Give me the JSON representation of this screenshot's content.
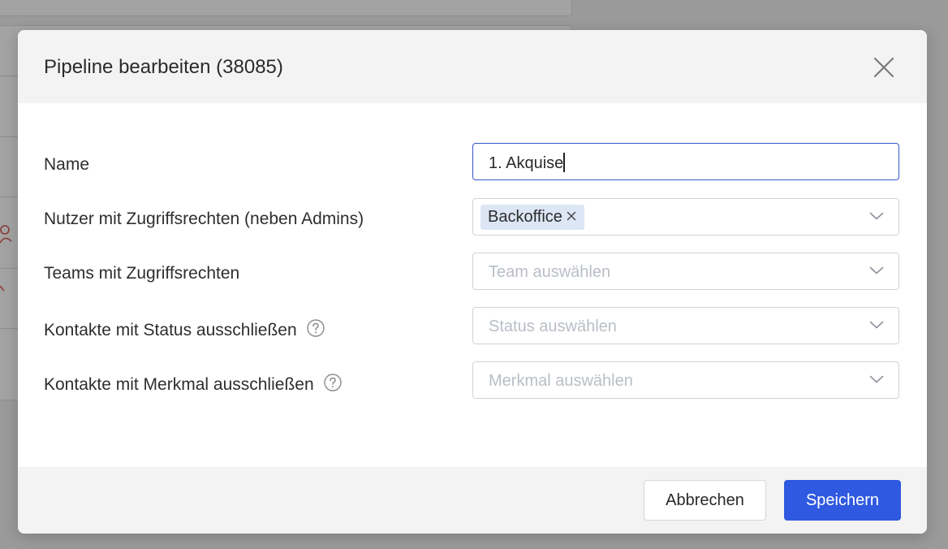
{
  "modal": {
    "title": "Pipeline bearbeiten (38085)"
  },
  "form": {
    "name": {
      "label": "Name",
      "value": "1. Akquise"
    },
    "users": {
      "label": "Nutzer mit Zugriffsrechten (neben Admins)",
      "tags": [
        "Backoffice"
      ]
    },
    "teams": {
      "label": "Teams mit Zugriffsrechten",
      "placeholder": "Team auswählen"
    },
    "status": {
      "label": "Kontakte mit Status ausschließen",
      "placeholder": "Status auswählen"
    },
    "feature": {
      "label": "Kontakte mit Merkmal ausschließen",
      "placeholder": "Merkmal auswählen"
    }
  },
  "footer": {
    "cancel_label": "Abbrechen",
    "save_label": "Speichern"
  },
  "icons": {
    "close": "close-icon",
    "chevron": "chevron-down-icon",
    "help": "question-circle-icon",
    "tag_remove": "x-icon"
  },
  "colors": {
    "primary": "#2f59e0",
    "focus_border": "#3557c9",
    "tag_bg": "#dde6f5",
    "header_bg": "#f3f3f3",
    "overlay": "#9a9a9a"
  }
}
